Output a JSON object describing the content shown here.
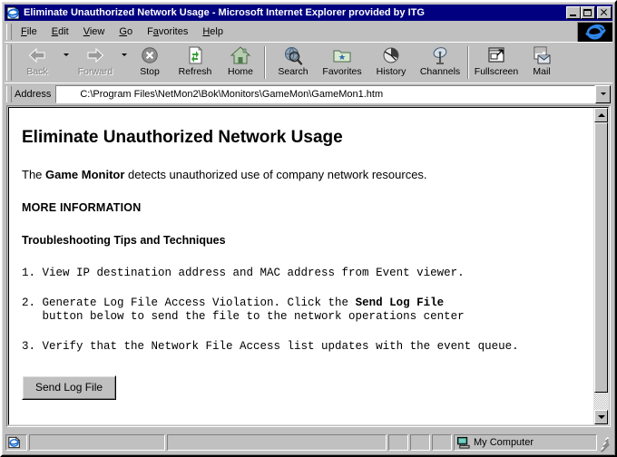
{
  "window": {
    "title": "Eliminate Unauthorized Network Usage - Microsoft Internet Explorer provided by ITG",
    "title_icon": "ie-document-icon",
    "minimize_label": "Minimize",
    "maximize_label": "Maximize",
    "close_label": "Close"
  },
  "menu": {
    "items": [
      {
        "pre": "",
        "accel": "F",
        "post": "ile"
      },
      {
        "pre": "",
        "accel": "E",
        "post": "dit"
      },
      {
        "pre": "",
        "accel": "V",
        "post": "iew"
      },
      {
        "pre": "",
        "accel": "G",
        "post": "o"
      },
      {
        "pre": "F",
        "accel": "a",
        "post": "vorites"
      },
      {
        "pre": "",
        "accel": "H",
        "post": "elp"
      }
    ],
    "logo": "ie-animated-logo"
  },
  "toolbar": {
    "buttons": [
      {
        "label": "Back",
        "icon": "back-arrow-icon",
        "disabled": true,
        "has_dropdown": true
      },
      {
        "label": "Forward",
        "icon": "forward-arrow-icon",
        "disabled": true,
        "has_dropdown": true
      },
      {
        "label": "Stop",
        "icon": "stop-icon",
        "disabled": false,
        "has_dropdown": false
      },
      {
        "label": "Refresh",
        "icon": "refresh-icon",
        "disabled": false,
        "has_dropdown": false
      },
      {
        "label": "Home",
        "icon": "home-icon",
        "disabled": false,
        "has_dropdown": false
      },
      {
        "label": "Search",
        "icon": "search-icon",
        "disabled": false,
        "has_dropdown": false
      },
      {
        "label": "Favorites",
        "icon": "favorites-folder-icon",
        "disabled": false,
        "has_dropdown": false
      },
      {
        "label": "History",
        "icon": "history-clock-icon",
        "disabled": false,
        "has_dropdown": false
      },
      {
        "label": "Channels",
        "icon": "channels-dish-icon",
        "disabled": false,
        "has_dropdown": false
      },
      {
        "label": "Fullscreen",
        "icon": "fullscreen-icon",
        "disabled": false,
        "has_dropdown": false
      },
      {
        "label": "Mail",
        "icon": "mail-envelope-icon",
        "disabled": false,
        "has_dropdown": false
      }
    ]
  },
  "address": {
    "label": "Address",
    "value": "C:\\Program Files\\NetMon2\\Bok\\Monitors\\GameMon\\GameMon1.htm",
    "dropdown_icon": "chevron-down-icon"
  },
  "page": {
    "heading": "Eliminate Unauthorized Network Usage",
    "intro_before": "The ",
    "intro_bold": "Game Monitor",
    "intro_after": " detects unauthorized use of company network resources.",
    "more_information_heading": "MORE INFORMATION",
    "troubleshooting_heading": "Troubleshooting Tips and Techniques",
    "steps": [
      {
        "text_before": "1. View IP destination address and MAC address from Event viewer.",
        "bold": "",
        "text_after": "",
        "line2": ""
      },
      {
        "text_before": "2. Generate Log File Access Violation. Click the ",
        "bold": "Send Log File",
        "text_after": "",
        "line2": "   button below to send the file to the network operations center"
      },
      {
        "text_before": "3. Verify that the Network File Access list updates with the event queue.",
        "bold": "",
        "text_after": "",
        "line2": ""
      }
    ],
    "send_log_button": "Send Log File"
  },
  "scrollbar": {
    "up_icon": "caret-up-icon",
    "down_icon": "caret-down-icon",
    "thumb": "scroll-thumb"
  },
  "statusbar": {
    "doc_icon": "ie-document-icon",
    "main_text": "",
    "progress_text": "",
    "panel_a": "",
    "panel_b": "",
    "panel_c": "",
    "zone_icon": "my-computer-icon",
    "zone_label": "My Computer"
  },
  "colors": {
    "titlebar": "#000080",
    "face": "#c0c0c0",
    "shadow": "#808080",
    "highlight": "#ffffff",
    "page_bg": "#ffffff",
    "text": "#000000"
  }
}
